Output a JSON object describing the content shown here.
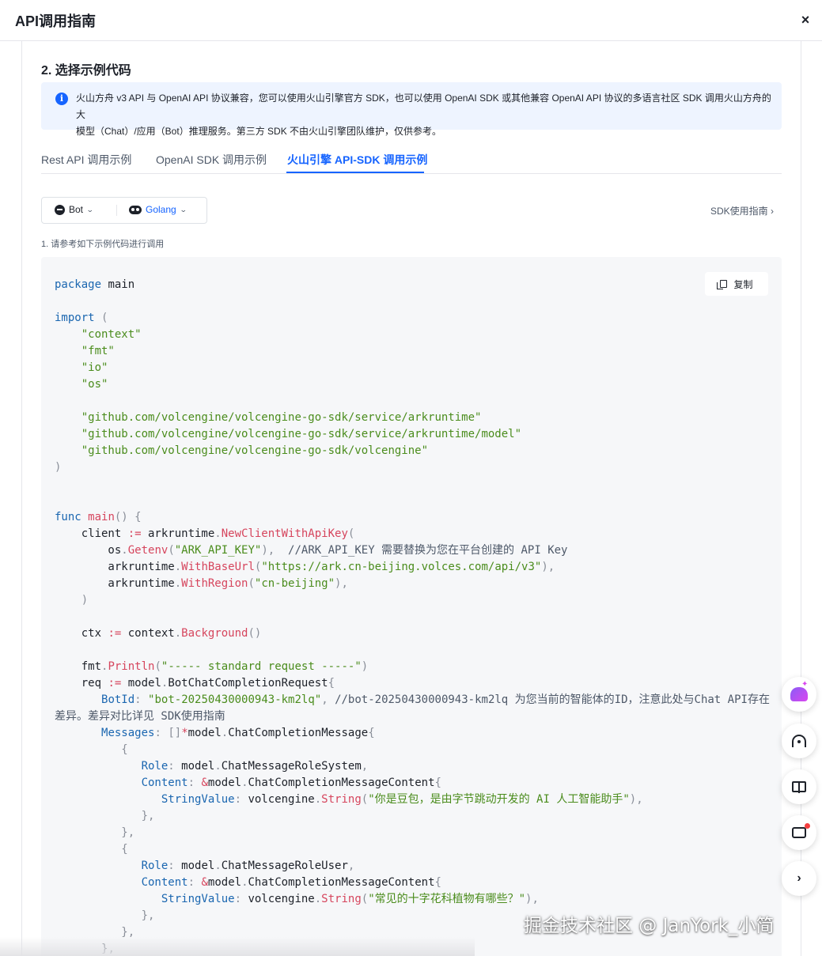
{
  "header": {
    "title": "API调用指南",
    "close_icon": "×"
  },
  "section": {
    "title": "2. 选择示例代码"
  },
  "info": {
    "icon": "i",
    "line1": "火山方舟 v3 API 与 OpenAI API 协议兼容，您可以使用火山引擎官方 SDK，也可以使用 OpenAI SDK 或其他兼容 OpenAI API 协议的多语言社区 SDK 调用火山方舟的大",
    "line2": "模型（Chat）/应用（Bot）推理服务。第三方 SDK 不由火山引擎团队维护，仅供参考。"
  },
  "tabs": [
    {
      "label": "Rest API 调用示例",
      "active": false
    },
    {
      "label": "OpenAI SDK 调用示例",
      "active": false
    },
    {
      "label": "火山引擎 API-SDK 调用示例",
      "active": true
    }
  ],
  "selector": {
    "mode_label": "Bot",
    "language_label": "Golang"
  },
  "sdk_link": "SDK使用指南 ›",
  "hint": "1. 请参考如下示例代码进行调用",
  "code": {
    "copy_label": "复制"
  },
  "colors": {
    "accent": "#1664ff",
    "keyword": "#1a66b0",
    "string": "#4a8c1c",
    "function": "#d6455d"
  },
  "floating_buttons": [
    "ai-assistant-icon",
    "headset-icon",
    "book-icon",
    "message-icon",
    "chevron-right-icon"
  ],
  "watermark": "掘金技术社区 @ JanYork_小简"
}
